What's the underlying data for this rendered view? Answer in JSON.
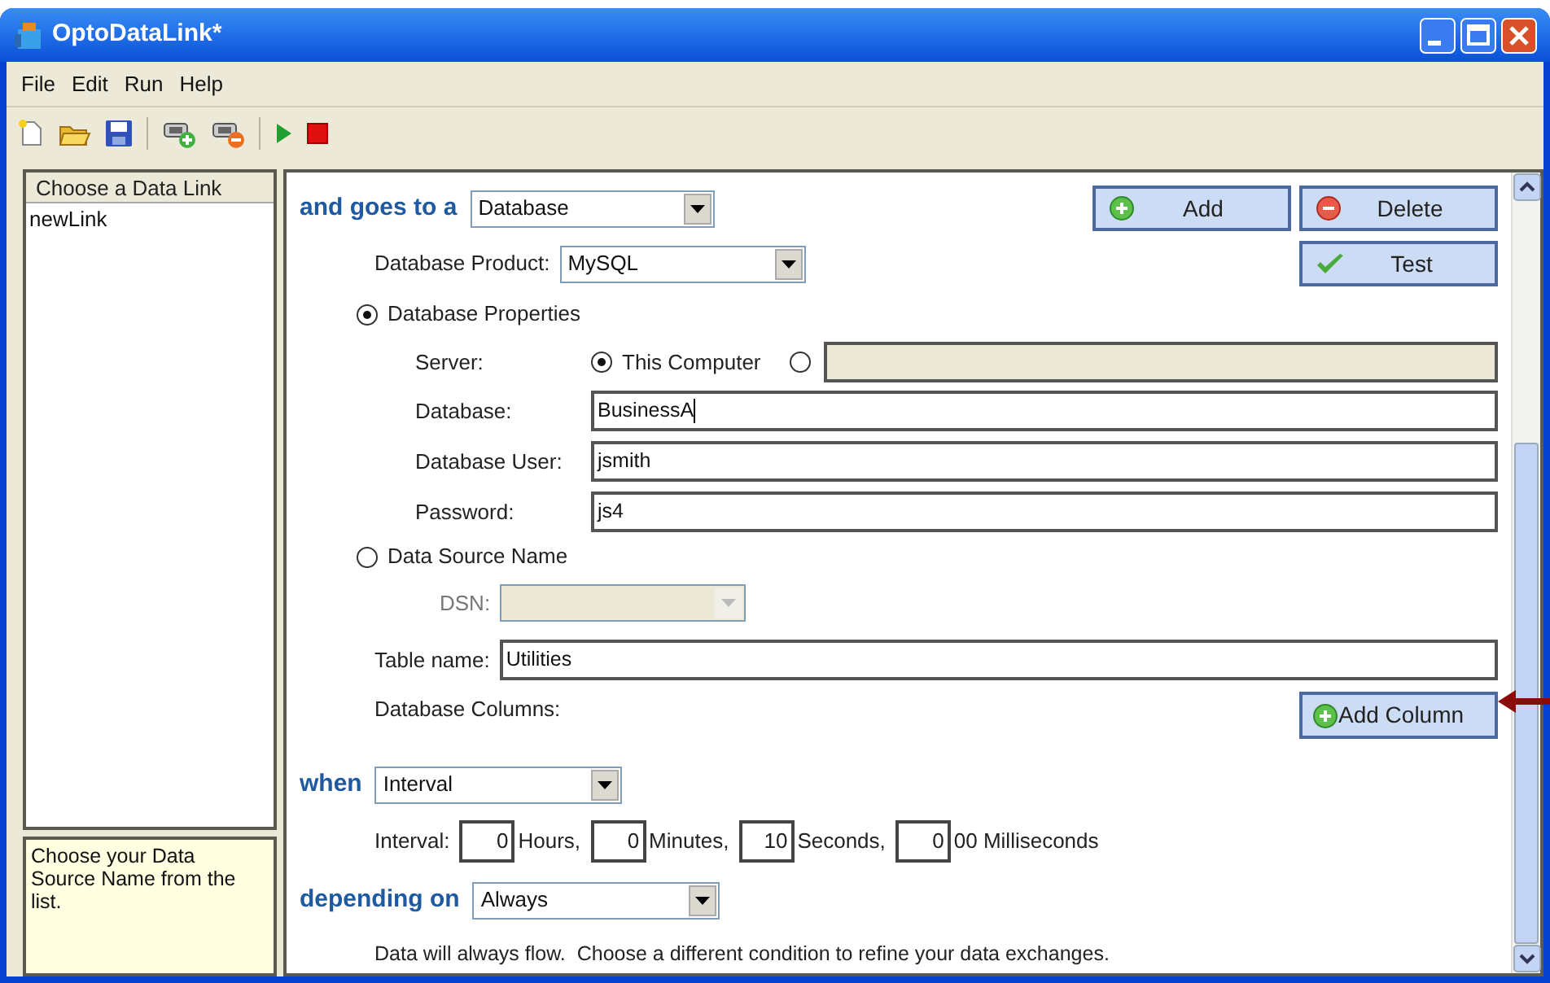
{
  "window": {
    "title": "OptoDataLink*"
  },
  "menu": [
    {
      "label": "File"
    },
    {
      "label": "Edit"
    },
    {
      "label": "Run"
    },
    {
      "label": "Help"
    }
  ],
  "sidebar": {
    "header": "Choose a Data Link",
    "items": [
      {
        "label": "newLink",
        "selected": false
      }
    ],
    "hint": "Choose your Data Source Name from the list."
  },
  "form": {
    "destination": {
      "label": "and goes to a",
      "value": "Database"
    },
    "buttons": [
      {
        "label": "Add",
        "kind": "add"
      },
      {
        "label": "Delete",
        "kind": "delete"
      },
      {
        "label": "Test",
        "kind": "test"
      }
    ],
    "product": {
      "label": "Database Product:",
      "value": "MySQL"
    },
    "properties_option": {
      "label": "Database Properties",
      "selected": true
    },
    "server": {
      "label": "Server:",
      "options": [
        {
          "label": "This Computer",
          "selected": true
        },
        {
          "selected": false
        }
      ],
      "other_field": {
        "disabled": true
      }
    },
    "fields": [
      {
        "label": "Database:",
        "value": "BusinessA",
        "focused": true
      },
      {
        "label": "Database User:",
        "value": "jsmith",
        "focused": false
      },
      {
        "label": "Password:",
        "value": "js4",
        "focused": false
      }
    ],
    "dsn_option": {
      "label": "Data Source Name",
      "selected": false
    },
    "dsn": {
      "label": "DSN:",
      "disabled": true
    },
    "table_name": {
      "label": "Table name:",
      "value": "Utilities"
    },
    "columns": {
      "label": "Database Columns:",
      "button": "Add Column"
    },
    "when": {
      "label": "when",
      "value": "Interval"
    },
    "interval": {
      "label": "Interval:",
      "parts": [
        {
          "value": "0",
          "unit": "Hours,"
        },
        {
          "value": "0",
          "unit": "Minutes,"
        },
        {
          "value": "10",
          "unit": "Seconds,"
        },
        {
          "value": "0",
          "unit": "00 Milliseconds"
        }
      ]
    },
    "depending": {
      "label": "depending on",
      "value": "Always",
      "note": "Data will always flow.  Choose a different condition to refine your data exchanges."
    }
  }
}
